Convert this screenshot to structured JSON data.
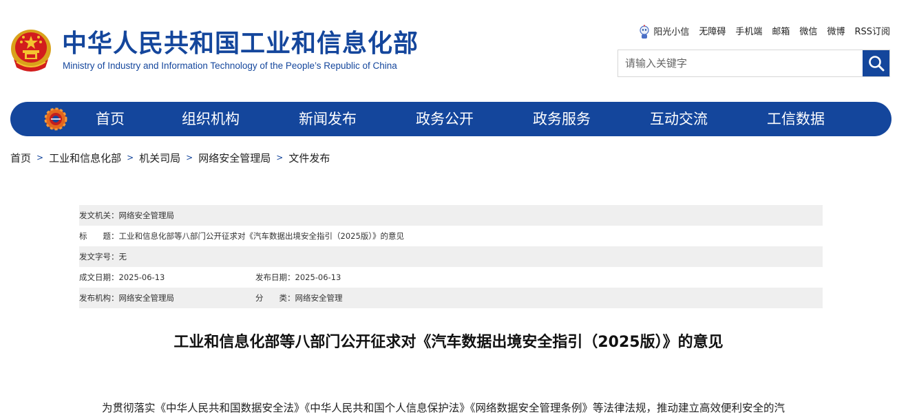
{
  "header": {
    "title": "中华人民共和国工业和信息化部",
    "subtitle": "Ministry of Industry and Information Technology of the People’s Republic of China"
  },
  "toplinks": [
    {
      "label": "阳光小信",
      "icon": "robot-icon"
    },
    {
      "label": "无障碍"
    },
    {
      "label": "手机端"
    },
    {
      "label": "邮箱"
    },
    {
      "label": "微信"
    },
    {
      "label": "微博"
    },
    {
      "label": "RSS订阅"
    }
  ],
  "search": {
    "placeholder": "请输入关键字",
    "value": "",
    "button_icon": "search-icon"
  },
  "nav": {
    "items": [
      "首页",
      "组织机构",
      "新闻发布",
      "政务公开",
      "政务服务",
      "互动交流",
      "工信数据"
    ]
  },
  "breadcrumb": [
    "首页",
    "工业和信息化部",
    "机关司局",
    "网络安全管理局",
    "文件发布"
  ],
  "info": {
    "issuer_label": "发文机关：",
    "issuer_value": "网络安全管理局",
    "title_label": "标　　题：",
    "title_value": "工业和信息化部等八部门公开征求对《汽车数据出境安全指引（2025版）》的意见",
    "docno_label": "发文字号：",
    "docno_value": "无",
    "created_label": "成文日期：",
    "created_value": "2025-06-13",
    "published_label": "发布日期：",
    "published_value": "2025-06-13",
    "org_label": "发布机构：",
    "org_value": "网络安全管理局",
    "category_label": "分　　类：",
    "category_value": "网络安全管理"
  },
  "article": {
    "title": "工业和信息化部等八部门公开征求对《汽车数据出境安全指引（2025版）》的意见",
    "first_line": "为贯彻落实《中华人民共和国数据安全法》《中华人民共和国个人信息保护法》《网络数据安全管理条例》等法律法规，推动建立高效便利安全的汽"
  },
  "colors": {
    "brand_blue": "#14469c",
    "shade_gray": "#efefef"
  }
}
